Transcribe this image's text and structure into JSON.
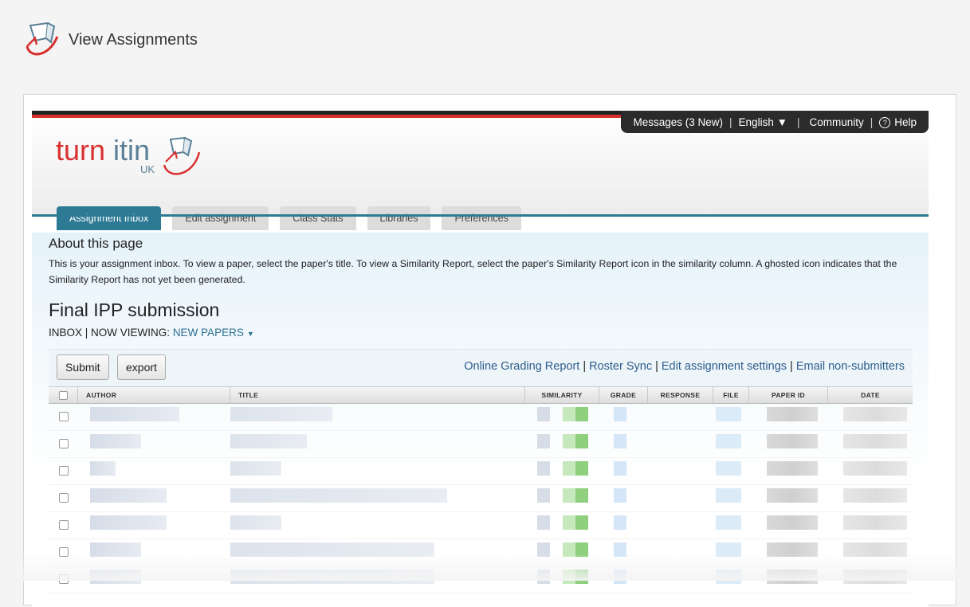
{
  "header": {
    "title": "View Assignments",
    "logo_icon": "turnitin-mark-icon"
  },
  "topnav": {
    "messages": "Messages (3 New)",
    "language": "English ▼",
    "community": "Community",
    "help": "Help"
  },
  "logo": {
    "wordmark_a": "turn",
    "wordmark_b": "itin",
    "region": "UK"
  },
  "tabs": [
    {
      "label": "Assignment Inbox",
      "active": true
    },
    {
      "label": "Edit assignment",
      "active": false
    },
    {
      "label": "Class Stats",
      "active": false
    },
    {
      "label": "Libraries",
      "active": false
    },
    {
      "label": "Preferences",
      "active": false
    }
  ],
  "about": {
    "title": "About this page",
    "text": "This is your assignment inbox. To view a paper, select the paper's title. To view a Similarity Report, select the paper's Similarity Report icon in the similarity column. A ghosted icon indicates that the Similarity Report has not yet been generated."
  },
  "assignment": {
    "title": "Final IPP submission",
    "inbox_label": "INBOX",
    "viewing_prefix": "| NOW VIEWING:",
    "viewing_value": "NEW PAPERS"
  },
  "toolbar": {
    "submit_label": "Submit",
    "export_label": "export",
    "links": [
      "Online Grading Report",
      "Roster Sync",
      "Edit assignment settings",
      "Email non-submitters"
    ]
  },
  "table": {
    "columns": [
      "",
      "Author",
      "Title",
      "Similarity",
      "Grade",
      "Response",
      "File",
      "Paper ID",
      "Date"
    ]
  },
  "colors": {
    "accent": "#2d7a94",
    "brand_red": "#d8302f",
    "link": "#2d5d8c"
  }
}
